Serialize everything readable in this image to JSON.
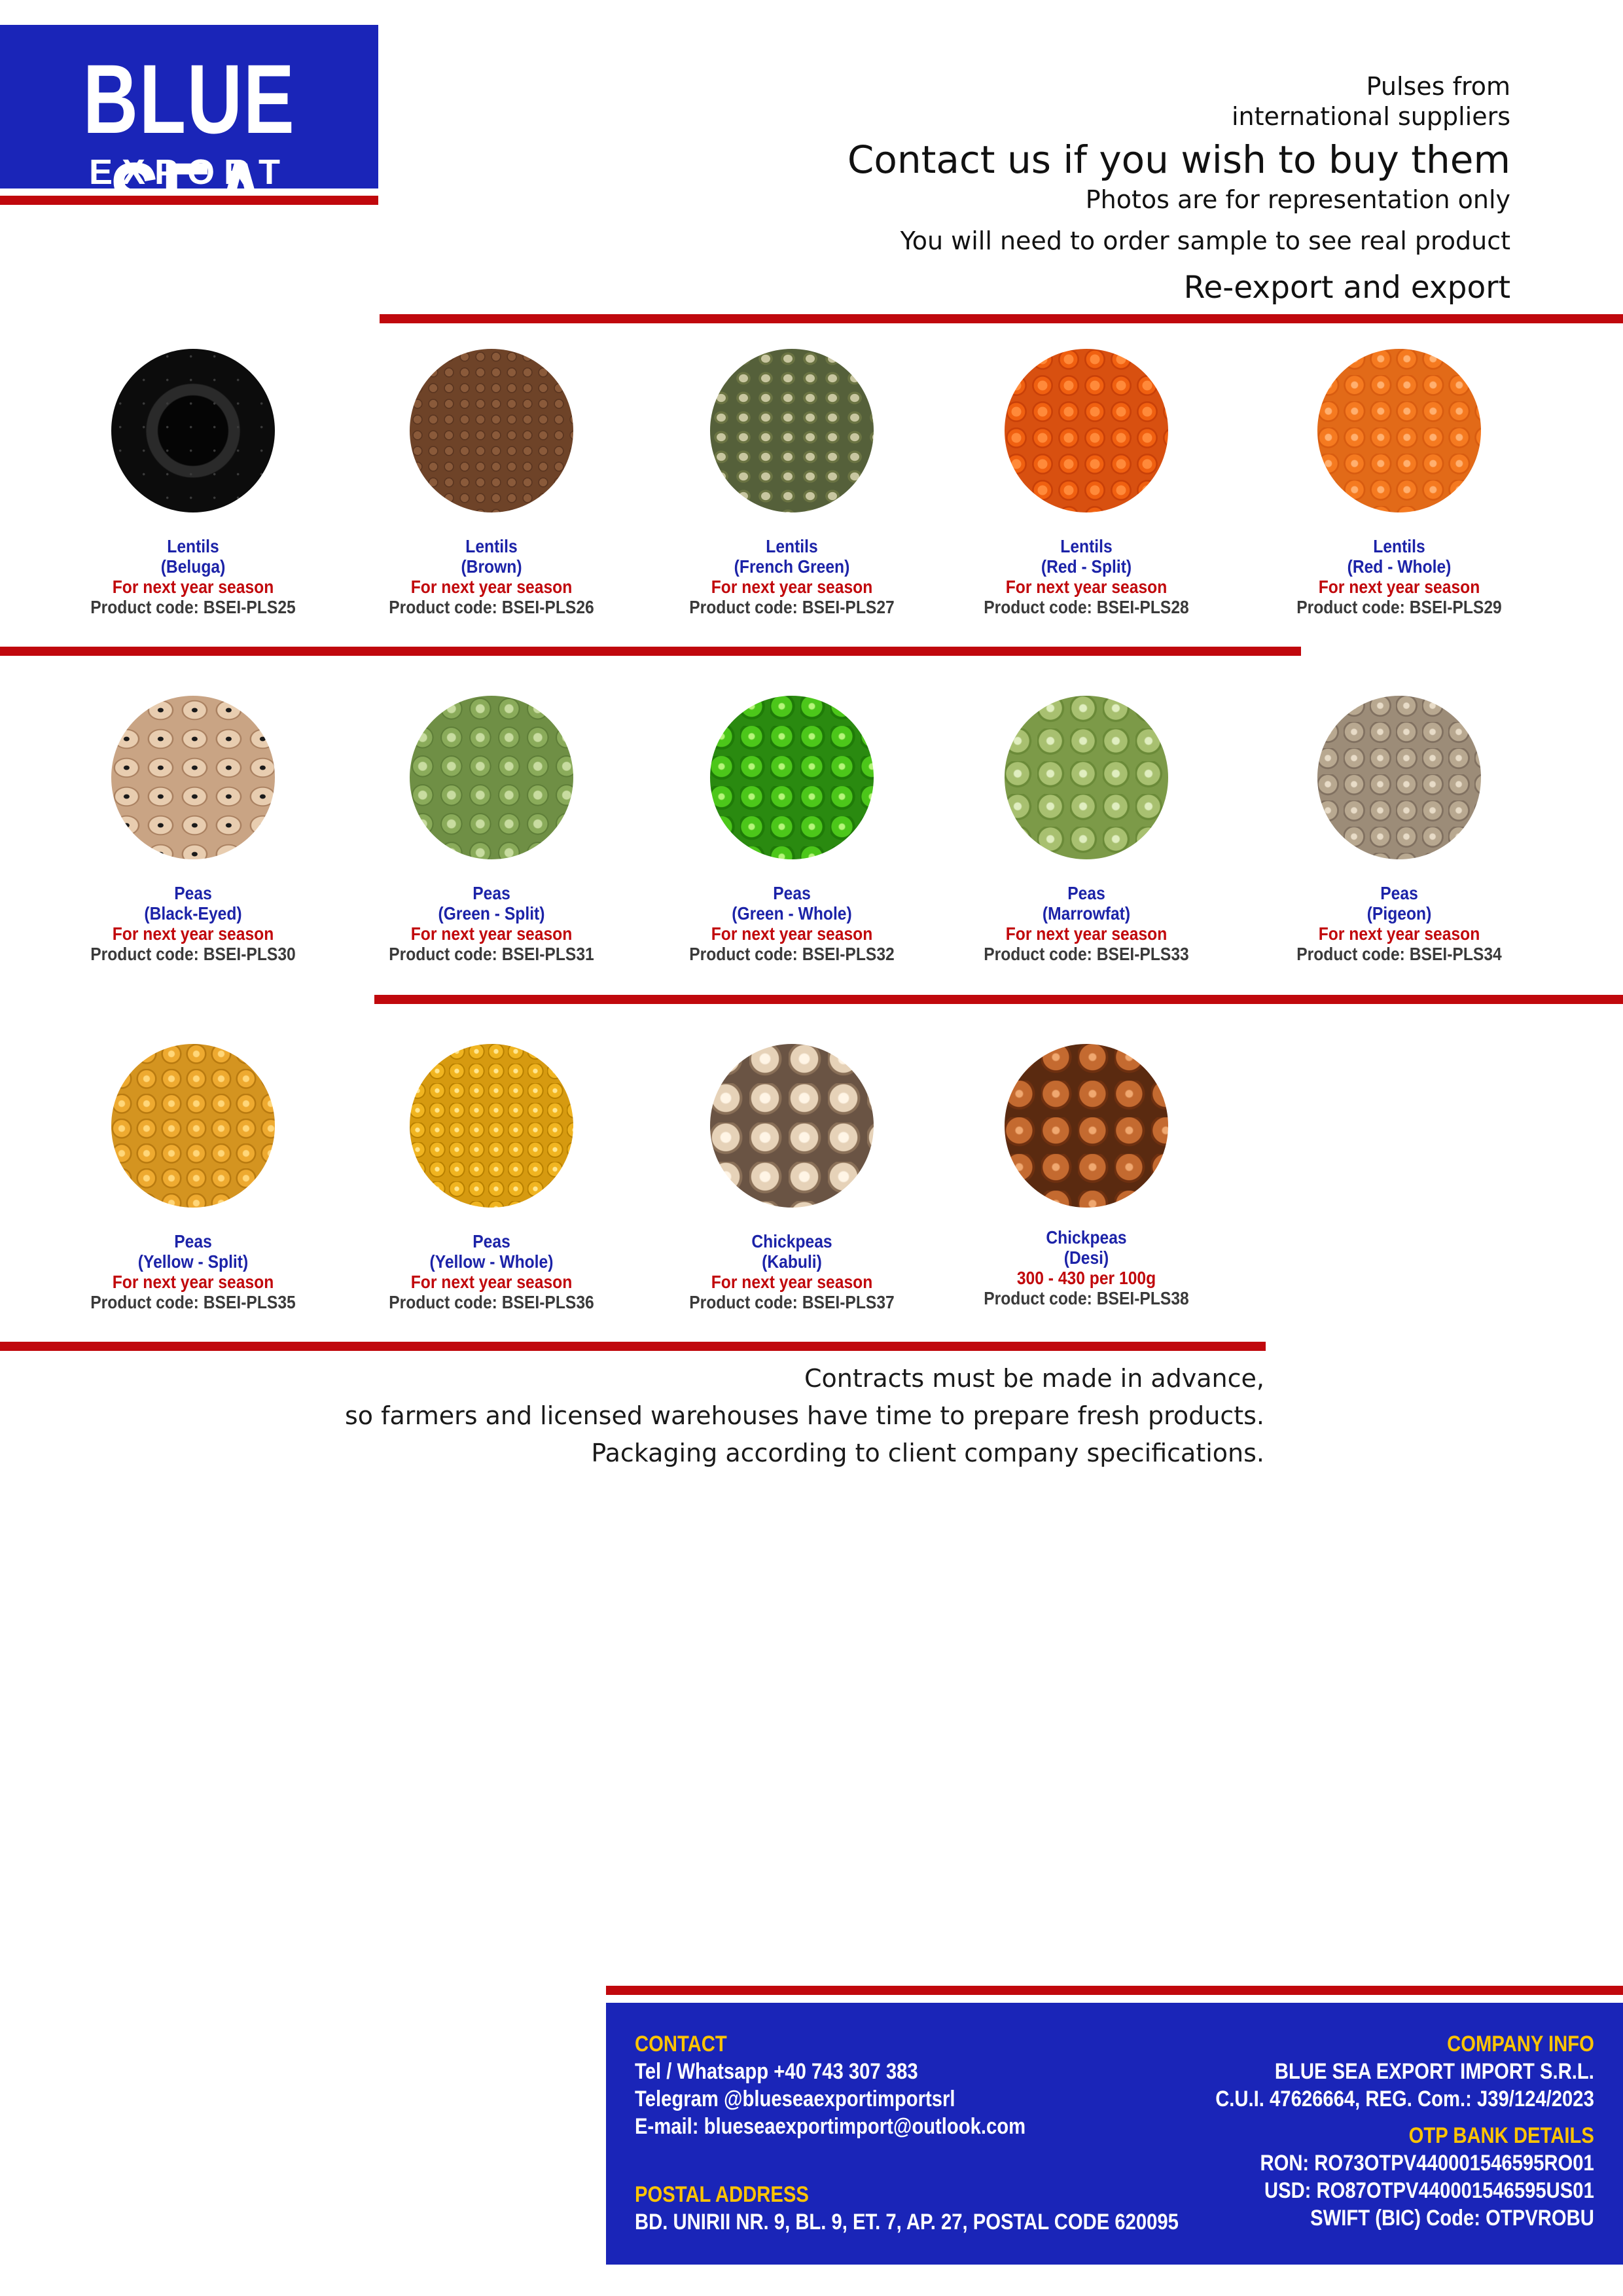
{
  "brand": {
    "line1": "BLUE SEA",
    "line2": "EXPORT IMPORT",
    "blue": "#1a25b8",
    "red": "#c0080d"
  },
  "header": {
    "line1": "Pulses from",
    "line2": "international suppliers",
    "headline": "Contact us if you wish to buy them",
    "note1": "Photos are for representation only",
    "note2": "You will need to order sample to see real product",
    "note3": "Re-export and export"
  },
  "rows": [
    [
      {
        "name": "Lentils",
        "variety": "(Beluga)",
        "status": "For next year season",
        "code": "Product code: BSEI-PLS25"
      },
      {
        "name": "Lentils",
        "variety": "(Brown)",
        "status": "For next year season",
        "code": "Product code: BSEI-PLS26"
      },
      {
        "name": "Lentils",
        "variety": "(French Green)",
        "status": "For next year season",
        "code": "Product code: BSEI-PLS27"
      },
      {
        "name": "Lentils",
        "variety": "(Red - Split)",
        "status": "For next year season",
        "code": "Product code: BSEI-PLS28"
      },
      {
        "name": "Lentils",
        "variety": "(Red - Whole)",
        "status": "For next year season",
        "code": "Product code: BSEI-PLS29"
      }
    ],
    [
      {
        "name": "Peas",
        "variety": "(Black-Eyed)",
        "status": "For next year season",
        "code": "Product code: BSEI-PLS30"
      },
      {
        "name": "Peas",
        "variety": "(Green - Split)",
        "status": "For next year season",
        "code": "Product code: BSEI-PLS31"
      },
      {
        "name": "Peas",
        "variety": "(Green - Whole)",
        "status": "For next year season",
        "code": "Product code: BSEI-PLS32"
      },
      {
        "name": "Peas",
        "variety": "(Marrowfat)",
        "status": "For next year season",
        "code": "Product code: BSEI-PLS33"
      },
      {
        "name": "Peas",
        "variety": "(Pigeon)",
        "status": "For next year season",
        "code": "Product code: BSEI-PLS34"
      }
    ],
    [
      {
        "name": "Peas",
        "variety": "(Yellow - Split)",
        "status": "For next year season",
        "code": "Product code: BSEI-PLS35"
      },
      {
        "name": "Peas",
        "variety": "(Yellow - Whole)",
        "status": "For next year season",
        "code": "Product code: BSEI-PLS36"
      },
      {
        "name": "Chickpeas",
        "variety": "(Kabuli)",
        "status": "For next year season",
        "code": "Product code: BSEI-PLS37"
      },
      {
        "name": "Chickpeas",
        "variety": "(Desi)",
        "status": "300 - 430 per 100g",
        "code": "Product code: BSEI-PLS38"
      }
    ]
  ],
  "closing": {
    "line1": "Contracts must be made in advance,",
    "line2": "so farmers and licensed warehouses have time to prepare fresh products.",
    "line3": "Packaging according to client company specifications."
  },
  "footer": {
    "contact_title": "CONTACT",
    "phone": "Tel / Whatsapp +40 743 307 383",
    "telegram": "Telegram @blueseaexportimportsrl",
    "email": "E-mail: blueseaexportimport@outlook.com",
    "postal_title": "POSTAL ADDRESS",
    "postal": "BD. UNIRII NR. 9, BL. 9, ET. 7, AP. 27, POSTAL CODE 620095",
    "company_title": "COMPANY INFO",
    "company_name": "BLUE SEA EXPORT IMPORT S.R.L.",
    "company_reg": "C.U.I. 47626664, REG. Com.: J39/124/2023",
    "bank_title": "OTP BANK DETAILS",
    "ron": "RON: RO73OTPV440001546595RO01",
    "usd": "USD: RO87OTPV440001546595US01",
    "swift": "SWIFT (BIC) Code: OTPVROBU"
  }
}
